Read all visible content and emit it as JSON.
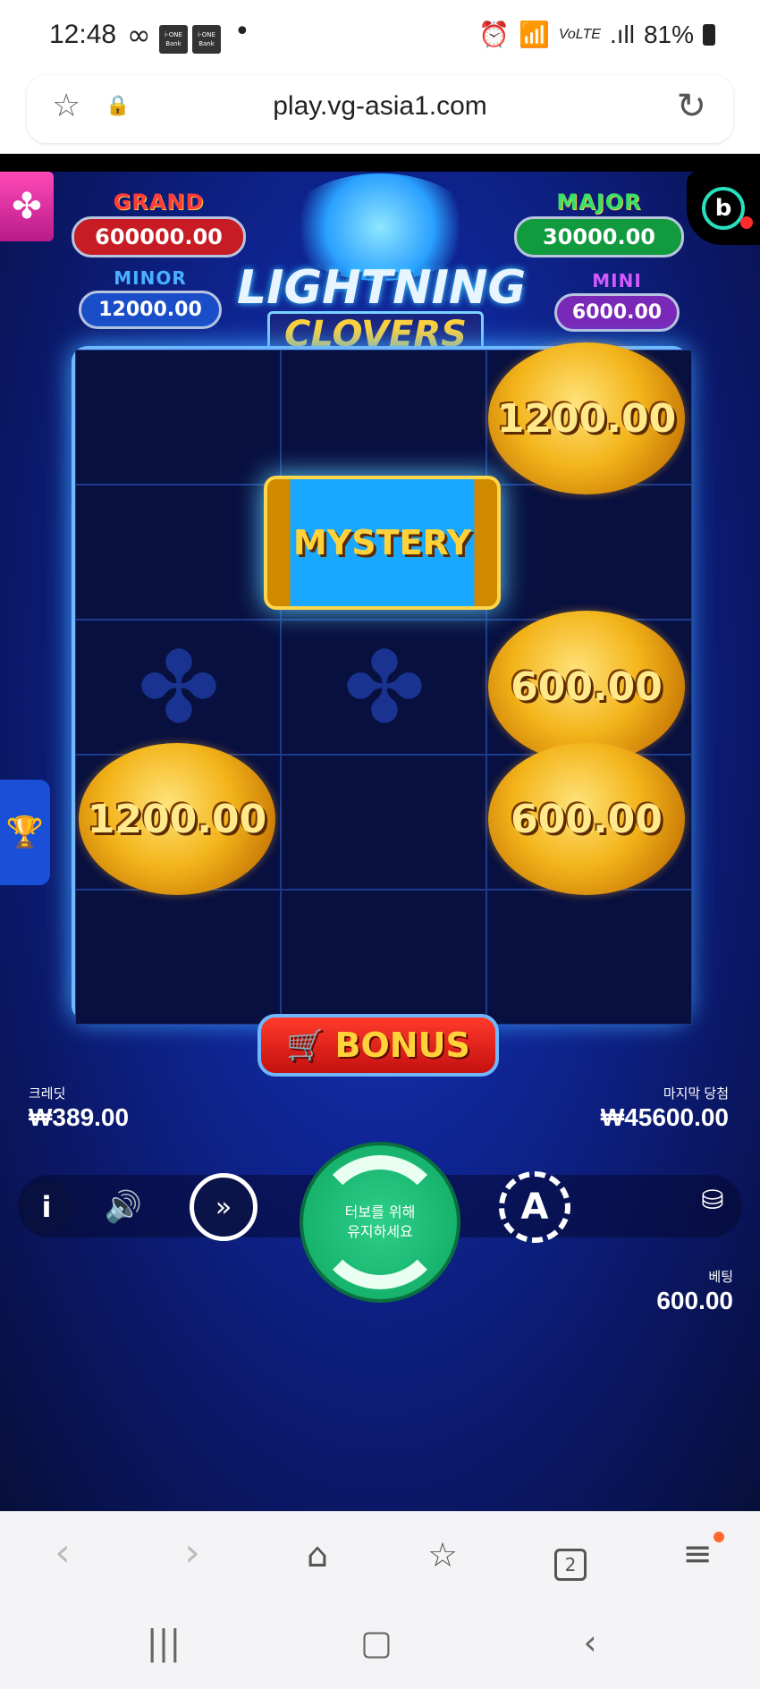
{
  "status_bar": {
    "time": "12:48",
    "infinity": "∞",
    "bank_badge_1": "i-ONE Bank",
    "bank_badge_2": "i-ONE Bank",
    "dot": "•",
    "network": "VoLTE",
    "signal": ".ıll",
    "battery": "81%"
  },
  "browser": {
    "url": "play.vg-asia1.com",
    "tabs_count": "2"
  },
  "game": {
    "logo_line1": "LIGHTNING",
    "logo_line2": "CLOVERS",
    "jackpots": {
      "grand_label": "GRAND",
      "grand_value": "600000.00",
      "major_label": "MAJOR",
      "major_value": "30000.00",
      "minor_label": "MINOR",
      "minor_value": "12000.00",
      "mini_label": "MINI",
      "mini_value": "6000.00"
    },
    "cells": {
      "r0c2": "1200.00",
      "r2c2": "600.00",
      "r3c0": "1200.00",
      "r3c2": "600.00",
      "mystery": "MYSTERY"
    },
    "bonus_label": "BONUS",
    "credit_label": "크레딧",
    "credit_value": "₩389.00",
    "last_win_label": "마지막 당첨",
    "last_win_value": "₩45600.00",
    "spin_line1": "터보를 위해",
    "spin_line2": "유지하세요",
    "bet_label": "베팅",
    "bet_value": "600.00"
  },
  "colors": {
    "grand": "#e0242c",
    "major": "#19a64a",
    "minor": "#1d5ecf",
    "mini": "#8a2fc9",
    "spin_button": "#17b36d"
  }
}
